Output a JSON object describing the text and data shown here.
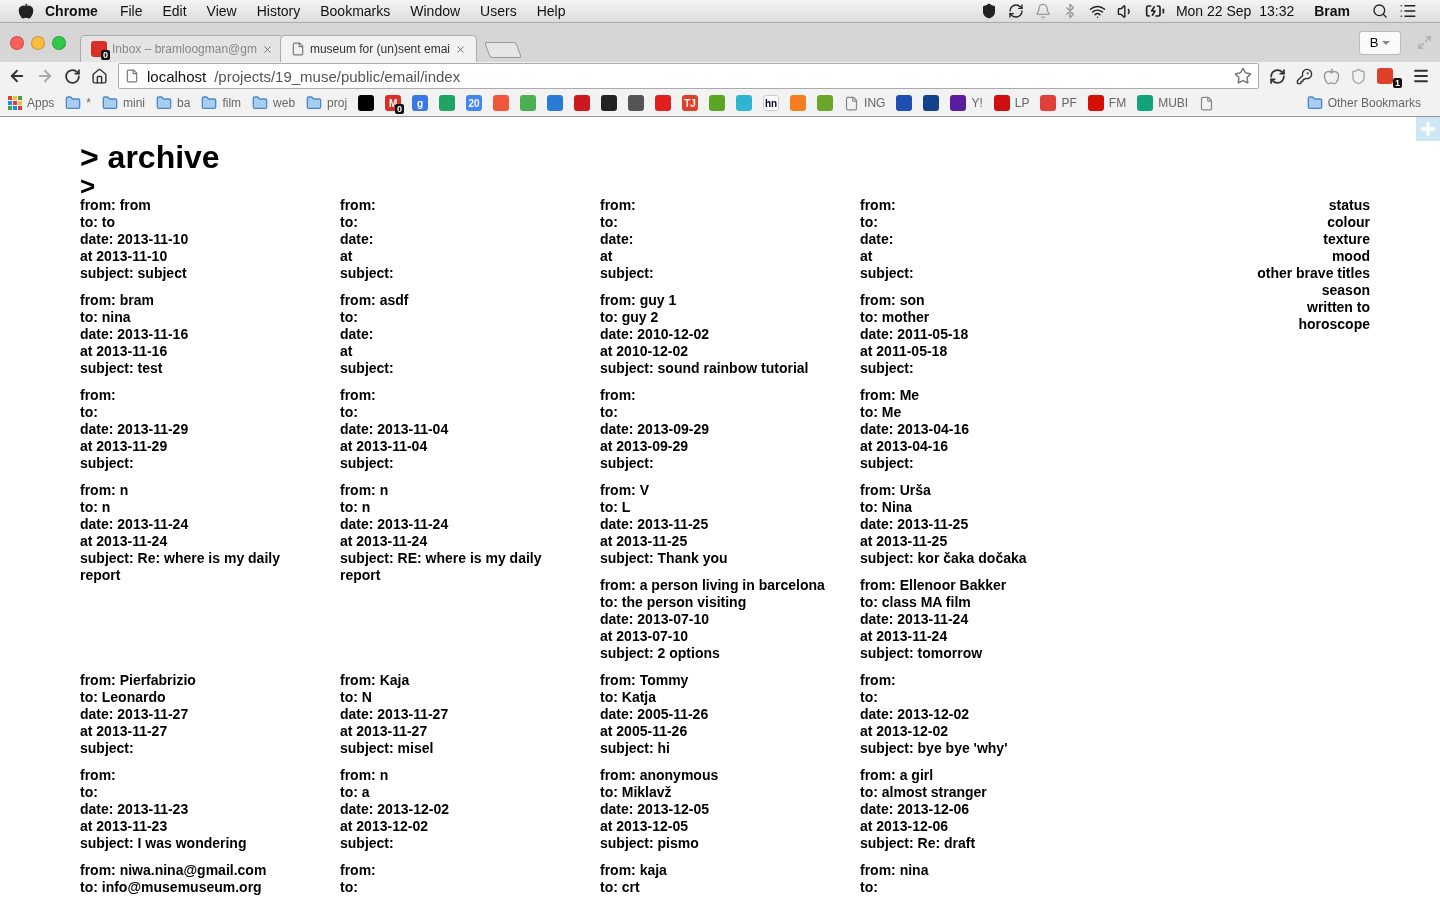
{
  "menubar": {
    "app": "Chrome",
    "menus": [
      "File",
      "Edit",
      "View",
      "History",
      "Bookmarks",
      "Window",
      "Users",
      "Help"
    ],
    "clock": "Mon 22 Sep  13:32",
    "user": "Bram"
  },
  "tabs": [
    {
      "title": "Inbox – bramloogman@gm",
      "badge": "0",
      "kind": "mail",
      "selected": false
    },
    {
      "title": "museum for (un)sent emai",
      "kind": "page",
      "selected": true
    }
  ],
  "profile": {
    "label": "B"
  },
  "address": {
    "host": "localhost",
    "path": "/projects/19_muse/public/email/index"
  },
  "extensions": [
    {
      "kind": "sync"
    },
    {
      "kind": "key"
    },
    {
      "kind": "apple"
    },
    {
      "kind": "shield"
    },
    {
      "kind": "tj",
      "badge": "1"
    }
  ],
  "bookmarks": [
    {
      "kind": "apps",
      "label": "Apps"
    },
    {
      "kind": "folder",
      "label": "*"
    },
    {
      "kind": "folder",
      "label": "mini"
    },
    {
      "kind": "folder",
      "label": "ba"
    },
    {
      "kind": "folder",
      "label": "film"
    },
    {
      "kind": "folder",
      "label": "web"
    },
    {
      "kind": "folder",
      "label": "proj"
    },
    {
      "kind": "site",
      "color": "#000000"
    },
    {
      "kind": "site",
      "color": "#d93025",
      "glyph": "M",
      "badge": "0"
    },
    {
      "kind": "site",
      "color": "#3b78e7",
      "glyph": "g"
    },
    {
      "kind": "site",
      "color": "#1fa463"
    },
    {
      "kind": "site",
      "color": "#4285f4",
      "glyph": "20"
    },
    {
      "kind": "site",
      "color": "#f0563a"
    },
    {
      "kind": "site",
      "color": "#4caf50"
    },
    {
      "kind": "site",
      "color": "#2b7bd6"
    },
    {
      "kind": "site",
      "color": "#cc181e"
    },
    {
      "kind": "site",
      "color": "#222222"
    },
    {
      "kind": "site",
      "color": "#555555"
    },
    {
      "kind": "site",
      "color": "#e02020"
    },
    {
      "kind": "site",
      "color": "#e0402a",
      "glyph": "TJ"
    },
    {
      "kind": "site",
      "color": "#5ba525"
    },
    {
      "kind": "site",
      "color": "#2fb5d2"
    },
    {
      "kind": "site",
      "color": "#ffffff",
      "glyph": "hn"
    },
    {
      "kind": "site",
      "color": "#f57c1f"
    },
    {
      "kind": "site",
      "color": "#6aa629"
    },
    {
      "kind": "page",
      "label": "ING"
    },
    {
      "kind": "site",
      "color": "#1f4fb0"
    },
    {
      "kind": "site",
      "color": "#13428a"
    },
    {
      "kind": "site",
      "color": "#5a1ea0",
      "label": "Y!"
    },
    {
      "kind": "site",
      "color": "#d01010",
      "label": "LP"
    },
    {
      "kind": "site",
      "color": "#e0403a",
      "label": "PF"
    },
    {
      "kind": "site",
      "color": "#d51007",
      "label": "FM"
    },
    {
      "kind": "site",
      "color": "#12a37a",
      "label": "MUBI"
    },
    {
      "kind": "page"
    }
  ],
  "other_bookmarks": "Other Bookmarks",
  "page": {
    "title": "> archive",
    "marker": ">"
  },
  "emails": [
    {
      "lines": [
        "from: from",
        "to: to",
        "date: 2013-11-10",
        "at 2013-11-10",
        "subject: subject"
      ]
    },
    {
      "lines": [
        "from:",
        "to:",
        "date:",
        "at",
        "subject:"
      ]
    },
    {
      "lines": [
        "from:",
        "to:",
        "date:",
        "at",
        "subject:"
      ]
    },
    {
      "lines": [
        "from:",
        "to:",
        "date:",
        "at",
        "subject:"
      ]
    },
    {
      "lines": [
        "from: bram",
        "to: nina",
        "date: 2013-11-16",
        "at 2013-11-16",
        "subject: test"
      ]
    },
    {
      "lines": [
        "from: asdf",
        "to:",
        "date:",
        "at",
        "subject:"
      ]
    },
    {
      "lines": [
        "from: guy 1",
        "to: guy 2",
        "date: 2010-12-02",
        "at 2010-12-02",
        "subject: sound rainbow tutorial"
      ]
    },
    {
      "lines": [
        "from: son",
        "to: mother",
        "date: 2011-05-18",
        "at 2011-05-18",
        "subject:"
      ]
    },
    {
      "lines": [
        "from:",
        "to:",
        "date: 2013-11-29",
        "at 2013-11-29",
        "subject:"
      ]
    },
    {
      "lines": [
        "from:",
        "to:",
        "date: 2013-11-04",
        "at 2013-11-04",
        "subject:"
      ]
    },
    {
      "lines": [
        "from:",
        "to:",
        "date: 2013-09-29",
        "at 2013-09-29",
        "subject:"
      ]
    },
    {
      "lines": [
        "from: Me",
        "to: Me",
        "date: 2013-04-16",
        "at 2013-04-16",
        "subject:"
      ]
    },
    {
      "lines": [
        "from: n",
        "to: n",
        "date: 2013-11-24",
        "at 2013-11-24",
        "subject: Re: where is my daily report"
      ]
    },
    {
      "lines": [
        "from: n",
        "to: n",
        "date: 2013-11-24",
        "at 2013-11-24",
        "subject: RE: where is my daily report"
      ]
    },
    {
      "lines": [
        "from: V",
        "to: L",
        "date: 2013-11-25",
        "at 2013-11-25",
        "subject: Thank you"
      ]
    },
    {
      "lines": [
        "from: Urša",
        "to: Nina",
        "date: 2013-11-25",
        "at 2013-11-25",
        "subject: kor čaka dočaka"
      ]
    },
    {
      "lines": [
        "from: a person living in barcelona",
        "to: the person visiting",
        "date: 2013-07-10",
        "at 2013-07-10",
        "subject: 2 options"
      ]
    },
    {
      "lines": [
        "from: Ellenoor Bakker",
        "to: class MA film",
        "date: 2013-11-24",
        "at 2013-11-24",
        "subject: tomorrow"
      ]
    },
    {
      "lines": [
        "from: Pierfabrizio",
        "to: Leonardo",
        "date: 2013-11-27",
        "at 2013-11-27",
        "subject:"
      ]
    },
    {
      "lines": [
        "from: Kaja",
        "to: N",
        "date: 2013-11-27",
        "at 2013-11-27",
        "subject: misel"
      ]
    },
    {
      "lines": [
        "from: Tommy",
        "to: Katja",
        "date: 2005-11-26",
        "at 2005-11-26",
        "subject: hi"
      ]
    },
    {
      "lines": [
        "from:",
        "to:",
        "date: 2013-12-02",
        "at 2013-12-02",
        "subject: bye bye 'why'"
      ]
    },
    {
      "lines": [
        "from:",
        "to:",
        "date: 2013-11-23",
        "at 2013-11-23",
        "subject: I was wondering"
      ]
    },
    {
      "lines": [
        "from: n",
        "to: a",
        "date: 2013-12-02",
        "at 2013-12-02",
        "subject:"
      ]
    },
    {
      "lines": [
        "from: anonymous",
        "to: Miklavž",
        "date: 2013-12-05",
        "at 2013-12-05",
        "subject: pismo"
      ]
    },
    {
      "lines": [
        "from: a girl",
        "to: almost stranger",
        "date: 2013-12-06",
        "at 2013-12-06",
        "subject: Re: draft"
      ]
    },
    {
      "lines": [
        "from: niwa.nina@gmail.com",
        "to: info@musemuseum.org"
      ]
    },
    {
      "lines": [
        "from:",
        "to:"
      ]
    },
    {
      "lines": [
        "from: kaja",
        "to: crt"
      ]
    },
    {
      "lines": [
        "from: nina",
        "to:"
      ]
    }
  ],
  "sort_menu": [
    "status",
    "colour",
    "texture",
    "mood",
    "other brave titles",
    "season",
    "written to",
    "horoscope"
  ]
}
